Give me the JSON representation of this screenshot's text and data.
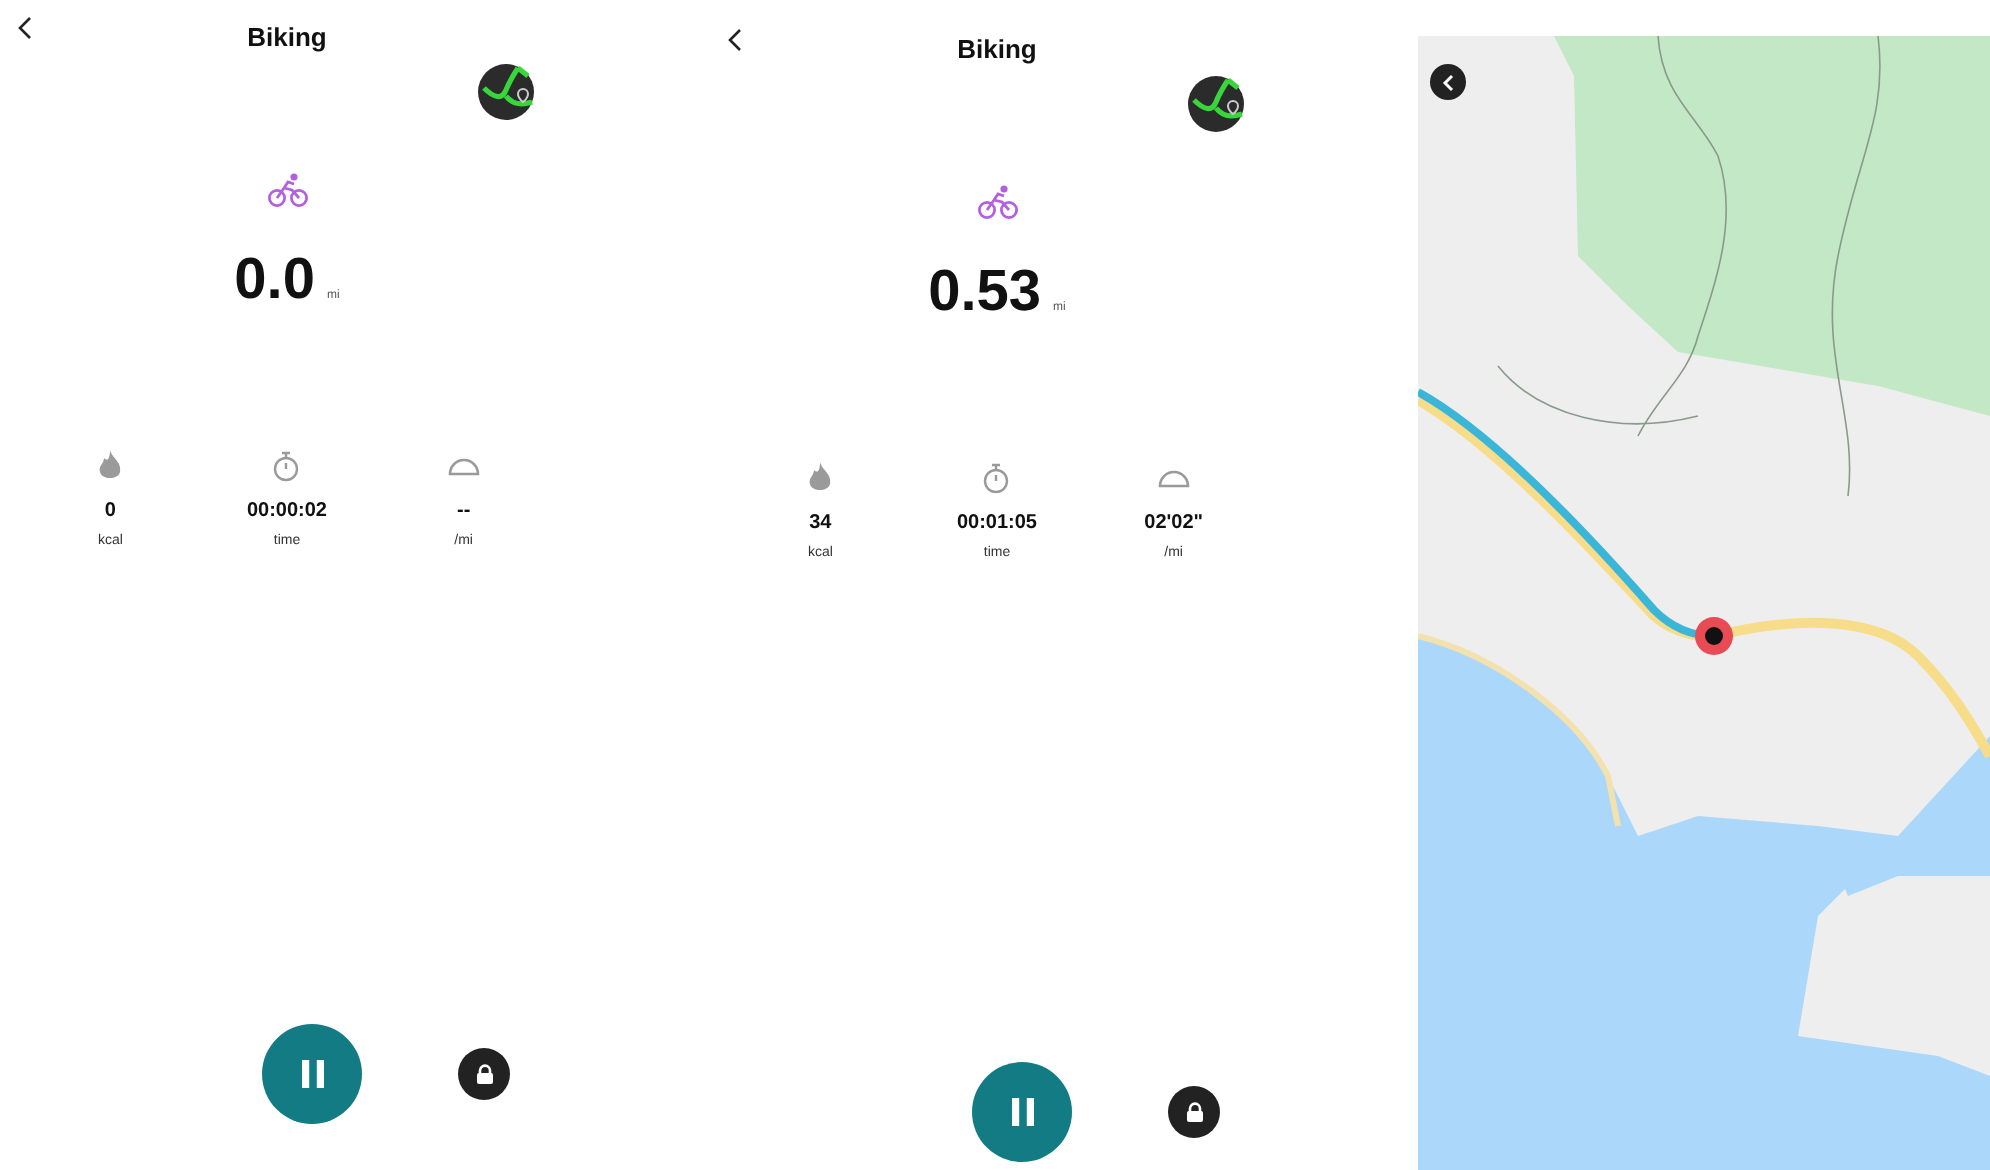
{
  "screens": [
    {
      "title": "Biking",
      "distance": "0.0",
      "unit": "mi",
      "stats": [
        {
          "kind": "calories",
          "value": "0",
          "label": "kcal"
        },
        {
          "kind": "time",
          "value": "00:00:02",
          "label": "time"
        },
        {
          "kind": "pace",
          "value": "--",
          "label": "/mi"
        }
      ]
    },
    {
      "title": "Biking",
      "distance": "0.53",
      "unit": "mi",
      "stats": [
        {
          "kind": "calories",
          "value": "34",
          "label": "kcal"
        },
        {
          "kind": "time",
          "value": "00:01:05",
          "label": "time"
        },
        {
          "kind": "pace",
          "value": "02'02\"",
          "label": "/mi"
        }
      ]
    }
  ]
}
